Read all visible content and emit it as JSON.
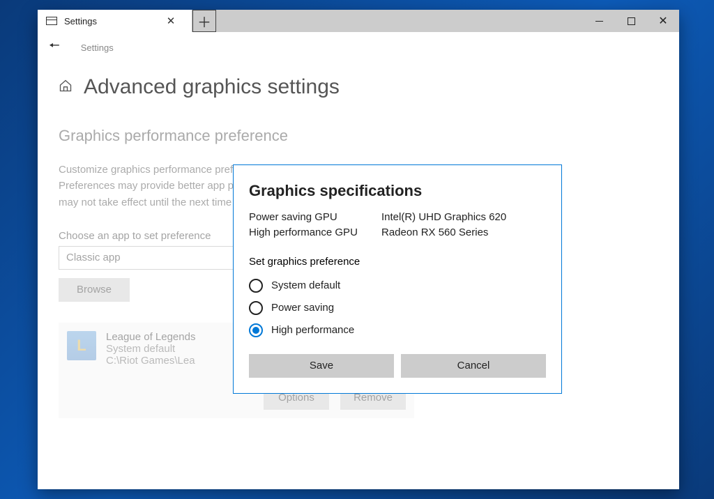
{
  "titlebar": {
    "tab_title": "Settings"
  },
  "breadcrumb": {
    "text": "Settings"
  },
  "header": {
    "title": "Advanced graphics settings"
  },
  "section": {
    "heading": "Graphics performance preference",
    "description": "Customize graphics performance preference for specific applications. Preferences may provide better app performance or save battery life. Choices may not take effect until the next time the app launches.",
    "choose_label": "Choose an app to set preference",
    "select_value": "Classic app",
    "browse_label": "Browse"
  },
  "app": {
    "name": "League of Legends",
    "pref": "System default",
    "path": "C:\\Riot Games\\Lea",
    "options_label": "Options",
    "remove_label": "Remove",
    "icon_letter": "L"
  },
  "modal": {
    "title": "Graphics specifications",
    "specs": [
      {
        "label": "Power saving GPU",
        "value": "Intel(R) UHD Graphics 620"
      },
      {
        "label": "High performance GPU",
        "value": "Radeon RX 560 Series"
      }
    ],
    "pref_label": "Set graphics preference",
    "options": [
      {
        "label": "System default",
        "selected": false
      },
      {
        "label": "Power saving",
        "selected": false
      },
      {
        "label": "High performance",
        "selected": true
      }
    ],
    "save_label": "Save",
    "cancel_label": "Cancel"
  }
}
